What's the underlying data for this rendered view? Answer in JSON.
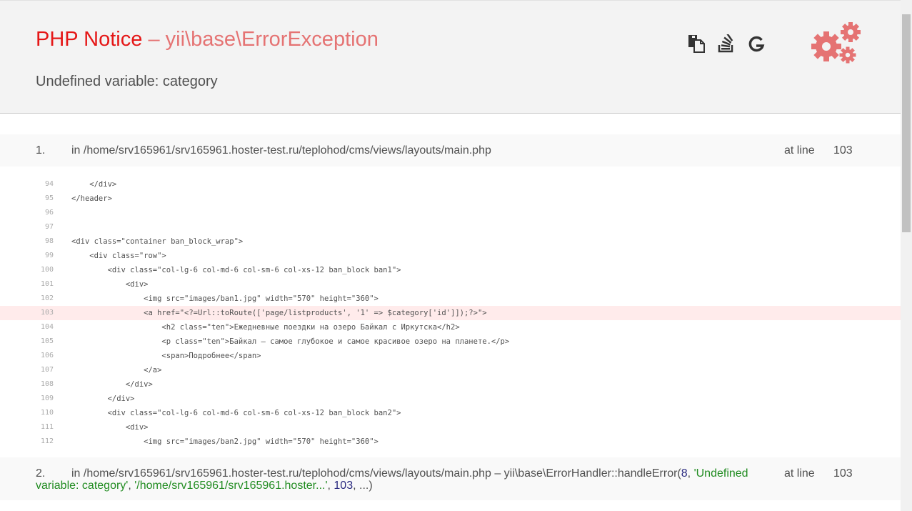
{
  "header": {
    "error_type": "PHP Notice",
    "separator": "–",
    "exception": "yii\\base\\ErrorException",
    "message": "Undefined variable: category",
    "tools": [
      {
        "name": "copy-icon"
      },
      {
        "name": "stackoverflow-icon"
      },
      {
        "name": "google-icon"
      }
    ],
    "accent_color": "#e57373"
  },
  "calls": [
    {
      "num": "1.",
      "file": "in /home/srv165961/srv165961.hoster-test.ru/teplohod/cms/views/layouts/main.php",
      "at_line_label": "at line",
      "line": "103",
      "code": [
        {
          "n": "94",
          "src": "    </div>"
        },
        {
          "n": "95",
          "src": "</header>"
        },
        {
          "n": "96",
          "src": ""
        },
        {
          "n": "97",
          "src": ""
        },
        {
          "n": "98",
          "src": "<div class=\"container ban_block_wrap\">"
        },
        {
          "n": "99",
          "src": "    <div class=\"row\">"
        },
        {
          "n": "100",
          "src": "        <div class=\"col-lg-6 col-md-6 col-sm-6 col-xs-12 ban_block ban1\">"
        },
        {
          "n": "101",
          "src": "            <div>"
        },
        {
          "n": "102",
          "src": "                <img src=\"images/ban1.jpg\" width=\"570\" height=\"360\">"
        },
        {
          "n": "103",
          "src": "                <a href=\"<?=Url::toRoute(['page/listproducts', '1' => $category['id']]);?>\">"
        },
        {
          "n": "104",
          "src": "                    <h2 class=\"ten\">Ежедневные поездки на озеро Байкал с Иркутска</h2>"
        },
        {
          "n": "105",
          "src": "                    <p class=\"ten\">Байкал — самое глубокое и самое красивое озеро на планете.</p>"
        },
        {
          "n": "106",
          "src": "                    <span>Подробнее</span>"
        },
        {
          "n": "107",
          "src": "                </a>"
        },
        {
          "n": "108",
          "src": "            </div>"
        },
        {
          "n": "109",
          "src": "        </div>"
        },
        {
          "n": "110",
          "src": "        <div class=\"col-lg-6 col-md-6 col-sm-6 col-xs-12 ban_block ban2\">"
        },
        {
          "n": "111",
          "src": "            <div>"
        },
        {
          "n": "112",
          "src": "                <img src=\"images/ban2.jpg\" width=\"570\" height=\"360\">"
        }
      ]
    },
    {
      "num": "2.",
      "file": "in /home/srv165961/srv165961.hoster-test.ru/teplohod/cms/views/layouts/main.php – yii\\base\\ErrorHandler::handleError(",
      "arg1": "8",
      "comma1": ", ",
      "arg2": "'Undefined variable: category'",
      "comma2": ", ",
      "arg3": "'/home/srv165961/srv165961.hoster...'",
      "comma3": ", ",
      "arg4": "103",
      "tail": ", ...)",
      "at_line_label": "at line",
      "line": "103"
    }
  ],
  "highlight_line": "103"
}
